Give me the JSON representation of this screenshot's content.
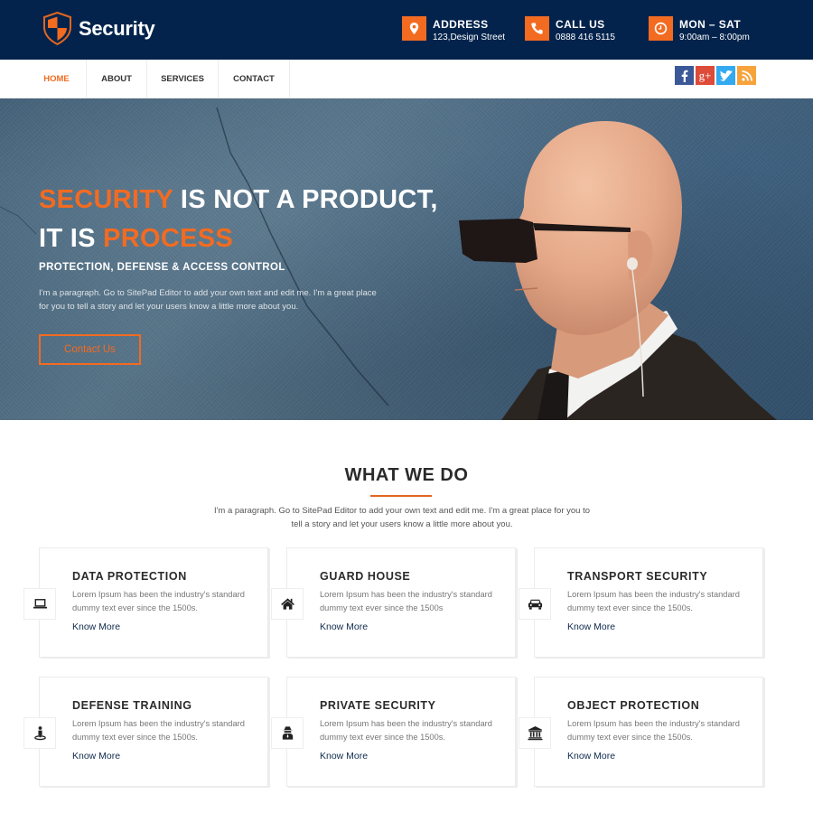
{
  "header": {
    "brand": "Security",
    "info": [
      {
        "icon": "map-pin-icon",
        "title": "ADDRESS",
        "sub": "123,Design Street"
      },
      {
        "icon": "phone-icon",
        "title": "CALL US",
        "sub": "0888 416 5115"
      },
      {
        "icon": "clock-icon",
        "title": "MON – SAT",
        "sub": "9:00am – 8:00pm"
      }
    ]
  },
  "nav": {
    "items": [
      {
        "label": "HOME",
        "active": true
      },
      {
        "label": "ABOUT"
      },
      {
        "label": "SERVICES"
      },
      {
        "label": "CONTACT"
      }
    ],
    "social": [
      {
        "name": "facebook",
        "glyph": "f",
        "color": "#3b5998"
      },
      {
        "name": "google-plus",
        "glyph": "g+",
        "color": "#dd4b39"
      },
      {
        "name": "twitter",
        "glyph": "t",
        "color": "#33aaf0"
      },
      {
        "name": "rss",
        "glyph": "rss",
        "color": "#f7a33c"
      }
    ]
  },
  "hero": {
    "title_line1_highlight": "SECURITY",
    "title_line1_rest": " IS NOT A PRODUCT,",
    "title_line2_start": "IT IS ",
    "title_line2_highlight": "PROCESS",
    "subtitle": "PROTECTION, DEFENSE & ACCESS CONTROL",
    "paragraph": "I'm a paragraph. Go to SitePad Editor to add your own text and edit me. I'm a great place for you to tell a story and let your users know a little more about you.",
    "button": "Contact Us"
  },
  "services": {
    "title": "WHAT WE DO",
    "paragraph": "I'm a paragraph. Go to SitePad Editor to add your own text and edit me. I'm a great place for you to tell a story and let your users know a little more about you.",
    "cards": [
      {
        "icon": "laptop-icon",
        "title": "DATA PROTECTION",
        "desc": "Lorem Ipsum has been the industry's standard dummy text ever since the 1500s.",
        "link": "Know More"
      },
      {
        "icon": "home-icon",
        "title": "GUARD HOUSE",
        "desc": "Lorem Ipsum has been the industry's standard dummy text ever since the 1500s",
        "link": "Know More"
      },
      {
        "icon": "car-icon",
        "title": "TRANSPORT SECURITY",
        "desc": "Lorem Ipsum has been the industry's standard dummy text ever since the 1500s.",
        "link": "Know More"
      },
      {
        "icon": "person-marker-icon",
        "title": "DEFENSE TRAINING",
        "desc": "Lorem Ipsum has been the industry's standard dummy text ever since the 1500s.",
        "link": "Know More"
      },
      {
        "icon": "user-secret-icon",
        "title": "PRIVATE SECURITY",
        "desc": "Lorem Ipsum has been the industry's standard dummy text ever since the 1500s.",
        "link": "Know More"
      },
      {
        "icon": "bank-icon",
        "title": "OBJECT PROTECTION",
        "desc": "Lorem Ipsum has been the industry's standard dummy text ever since the 1500s.",
        "link": "Know More"
      }
    ]
  },
  "colors": {
    "header_bg": "#03234c",
    "accent": "#f26b21",
    "link": "#0e2a4c"
  }
}
